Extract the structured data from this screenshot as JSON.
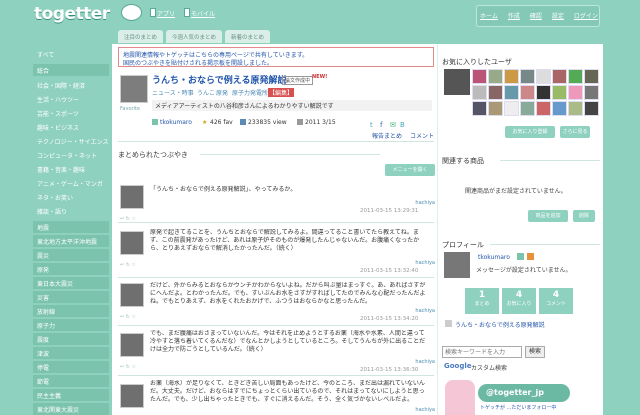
{
  "header": {
    "logo": "togetter",
    "app_link": "アプリ",
    "mobile_link": "モバイル",
    "nav": [
      "ホーム",
      "作成",
      "確認",
      "設定",
      "ログイン"
    ]
  },
  "tabs": [
    "注目のまとめ",
    "今週人気のまとめ",
    "新着のまとめ"
  ],
  "sidebar": {
    "items": [
      "すべて",
      "総合",
      "社会・国際・経済",
      "生活・ハウツー",
      "芸能・スポーツ",
      "趣味・ビジネス",
      "テクノロジー・サイエンス",
      "コンピュータ・ネット",
      "書籍・音楽・趣味",
      "アニメ・ゲーム・マンガ",
      "ネタ・お笑い",
      "雑談・語り",
      "地震",
      "東北地方太平洋沖地震",
      "震災",
      "原発",
      "東日本大震災",
      "災害",
      "放射線",
      "原子力",
      "震度",
      "津波",
      "停電",
      "節電",
      "民主主義",
      "東北関東大震災"
    ]
  },
  "notice": {
    "line1": "地震関連情報やトゲッチはこちらの専用ページで共有していきます。",
    "line2": "国民のつぶやきを貼付けされる掲示板を開設しました。"
  },
  "summary": {
    "fav_label": "Favorite",
    "title": "うんち・おならで例える原発解説",
    "badge": "論文作成中",
    "new_badge": "NEW!",
    "tags": [
      "ニュース・時事",
      "うんこ",
      "原発",
      "原子力発電所"
    ],
    "edit_label": "【編集】",
    "description": "メディアアーティストの八谷和彦さんによるわかりやすい解説です",
    "author": "tkokumaro",
    "fav_count": "426 fav",
    "views": "233835 view",
    "date": "2011 3/15",
    "actions": [
      "報告まとめ",
      "コメント"
    ]
  },
  "section": {
    "title": "まとめられたつぶやき",
    "menu_button": "メニューを開く"
  },
  "tweets": [
    {
      "text": "「うんち・おならで例える原発解説」、やってみるか。",
      "user": "hachiya",
      "date": "2011-03-15 13:29:31"
    },
    {
      "text": "原発で起きてることを、うんちとおならで解説してみるよ。間違ってること書いてたら教えてね。まず、この前震発があったけど、あれは原子炉そのものが爆発したんじゃないんだ。お腹痛くなったから、とりあえずおならで解消したかったんだ。（続く）",
      "user": "hachiya",
      "date": "2011-03-15 13:32:40"
    },
    {
      "text": "だけど、外からみるとおならかウンチかわからないよね。だから叫ぶ量はまっすぐ。あ、あればさすがにへんだよ。とわかったんだ。でも、すいぶんお水をさすがすればしてたのでみんな心配だったんだよね。でもとりあえず、お水をくれたおかげで、ふつうはおならかなと思ったんだ。",
      "user": "hachiya",
      "date": "2011-03-15 13:34:20"
    },
    {
      "text": "でも、まだ腹痛はおさまっていないんだ。今はそれを止めようとするお薬（海水や水素、人間と違って冷やすと落ち着いてくるんだな）でなんとかしようとしているところ。そしてうんちが外に出ることだけは全力で防ごうとしているんだ。（続く）",
      "user": "hachiya",
      "date": "2011-03-15 13:36:30"
    },
    {
      "text": "お薬（海水）が足りなくて、ときどき苦しい局面もあったけど、今のところ、まだ出は漏れていないんだ。大丈夫。だけど、おならはすでにちょっとくらい出ているので、それはまってないにしようと思ったんだ。でも、少し出ちゃったときでも、すぐに消えるんだ。そう、全く気づかないレベルだよ。",
      "user": "hachiya",
      "date": "2011-03-15 13:38:30"
    }
  ],
  "right": {
    "fav_users_title": "お気に入りしたユーザ",
    "fav_users_buttons": [
      "お気に入り登録",
      "さらに見る"
    ],
    "products_title": "関連する商品",
    "products_text": "関連商品がまだ設定されていません。",
    "products_buttons": [
      "商品を追加",
      "削除"
    ],
    "profile_title": "プロフィール",
    "profile_user": "tkokumaro",
    "profile_msg": "メッセージが設定されていません。",
    "stats": [
      {
        "num": "1",
        "label": "まとめ"
      },
      {
        "num": "4",
        "label": "お気に入り"
      },
      {
        "num": "4",
        "label": "コメント"
      }
    ],
    "profile_link": "うんち・おならで例える原発解説",
    "search_placeholder": "検索キーワードを入力",
    "search_button": "検索",
    "google_label": "Google",
    "custom_search": "カスタム検索",
    "banner_text": "@togetter_jp",
    "banner_sub": "トゲッチが ...ただいまフォロー中"
  },
  "colors": {
    "bg": "#8fd1bf",
    "accent": "#5aa993",
    "link": "#2255aa",
    "notice_border": "#e28a8a"
  }
}
